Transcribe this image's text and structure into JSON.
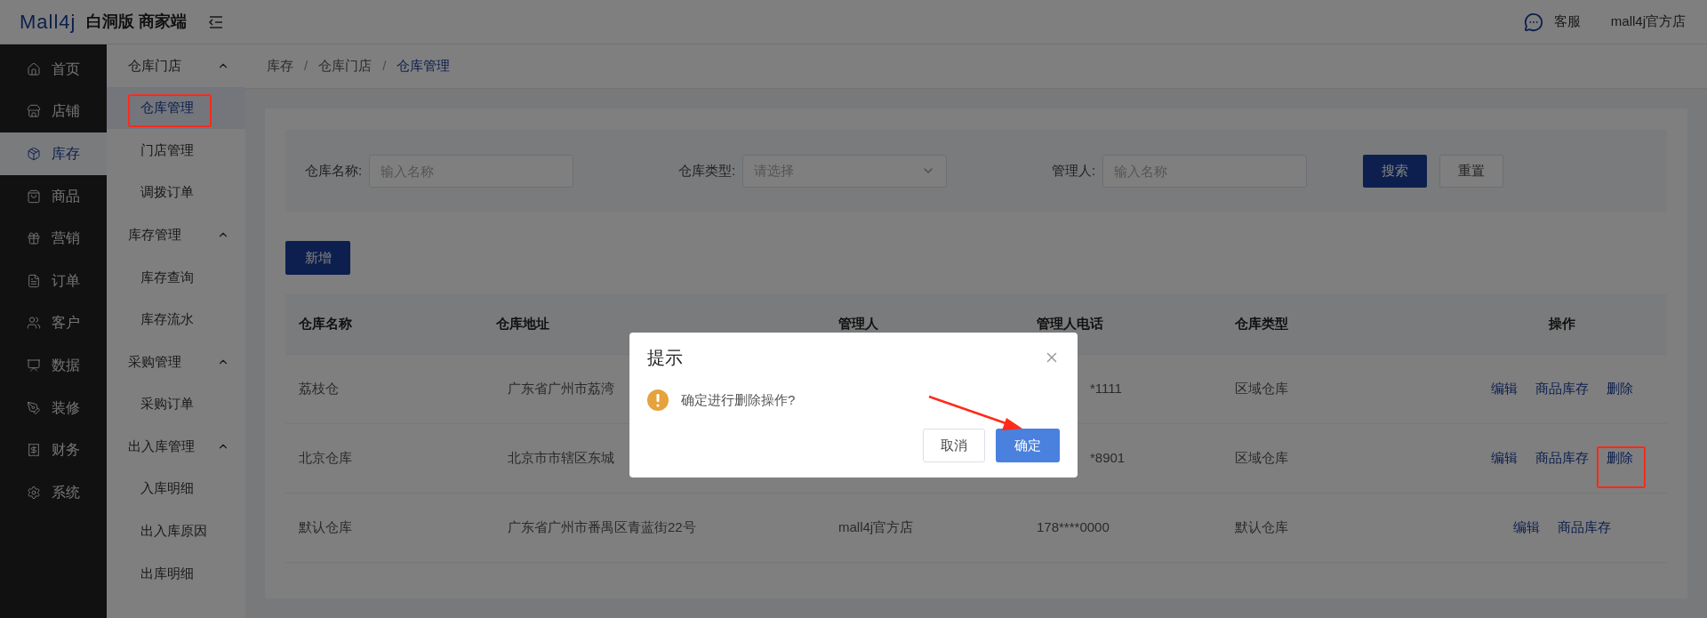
{
  "header": {
    "logo": "Mall4j",
    "edition": "白洞版 商家端",
    "service": "客服",
    "shop": "mall4j官方店"
  },
  "main_menu": [
    {
      "label": "首页",
      "selected": false
    },
    {
      "label": "店铺",
      "selected": false
    },
    {
      "label": "库存",
      "selected": true
    },
    {
      "label": "商品",
      "selected": false
    },
    {
      "label": "营销",
      "selected": false
    },
    {
      "label": "订单",
      "selected": false
    },
    {
      "label": "客户",
      "selected": false
    },
    {
      "label": "数据",
      "selected": false
    },
    {
      "label": "装修",
      "selected": false
    },
    {
      "label": "财务",
      "selected": false
    },
    {
      "label": "系统",
      "selected": false
    }
  ],
  "sub_menu": [
    {
      "label": "仓库门店",
      "expanded": true,
      "children": [
        {
          "label": "仓库管理",
          "selected": true
        },
        {
          "label": "门店管理",
          "selected": false
        },
        {
          "label": "调拨订单",
          "selected": false
        }
      ]
    },
    {
      "label": "库存管理",
      "expanded": true,
      "children": [
        {
          "label": "库存查询",
          "selected": false
        },
        {
          "label": "库存流水",
          "selected": false
        }
      ]
    },
    {
      "label": "采购管理",
      "expanded": true,
      "children": [
        {
          "label": "采购订单",
          "selected": false
        }
      ]
    },
    {
      "label": "出入库管理",
      "expanded": true,
      "children": [
        {
          "label": "入库明细",
          "selected": false
        },
        {
          "label": "出入库原因",
          "selected": false
        },
        {
          "label": "出库明细",
          "selected": false
        }
      ]
    }
  ],
  "breadcrumb": [
    "库存",
    "仓库门店",
    "仓库管理"
  ],
  "breadcrumb_separator": "/",
  "filters": [
    {
      "label": "仓库名称:",
      "kind": "input",
      "placeholder": "输入名称"
    },
    {
      "label": "仓库类型:",
      "kind": "select",
      "placeholder": "请选择"
    },
    {
      "label": "管理人:",
      "kind": "input",
      "placeholder": "输入名称"
    }
  ],
  "search_button": "搜索",
  "reset_button": "重置",
  "add_button": "新增",
  "table": {
    "columns": [
      "仓库名称",
      "仓库地址",
      "管理人",
      "管理人电话",
      "仓库类型",
      "操作"
    ],
    "rows": [
      {
        "name": "荔枝仓",
        "address": "广东省广州市荔湾",
        "phone": "*1111",
        "phone_clipped": true,
        "type": "区域仓库",
        "actions": [
          "编辑",
          "商品库存",
          "删除"
        ]
      },
      {
        "name": "北京仓库",
        "address": "北京市市辖区东城",
        "phone": "*8901",
        "phone_clipped": true,
        "type": "区域仓库",
        "actions": [
          "编辑",
          "商品库存",
          "删除"
        ]
      },
      {
        "name": "默认仓库",
        "address": "广东省广州市番禺区青蓝街22号",
        "manager": "mall4j官方店",
        "phone": "178****0000",
        "phone_clipped": false,
        "type": "默认仓库",
        "actions": [
          "编辑",
          "商品库存"
        ]
      }
    ]
  },
  "dialog": {
    "title": "提示",
    "message": "确定进行删除操作?",
    "cancel": "取消",
    "confirm": "确定"
  }
}
